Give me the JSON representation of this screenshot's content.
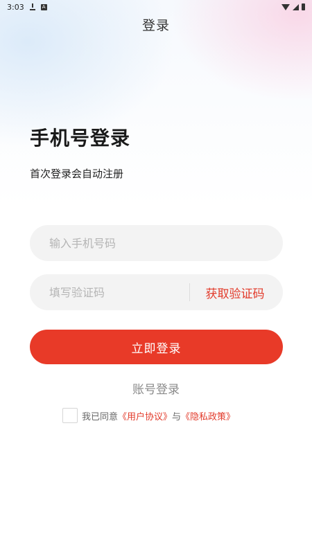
{
  "status_bar": {
    "time": "3:03",
    "icons": [
      "download-icon",
      "a-icon",
      "wifi-icon",
      "signal-icon",
      "battery-icon"
    ]
  },
  "nav": {
    "title": "登录"
  },
  "heading": "手机号登录",
  "subtext": "首次登录会自动注册",
  "phone_field": {
    "placeholder": "输入手机号码",
    "value": ""
  },
  "code_field": {
    "placeholder": "填写验证码",
    "value": "",
    "get_code_label": "获取验证码"
  },
  "login_button": {
    "label": "立即登录"
  },
  "account_login": {
    "label": "账号登录"
  },
  "agreement": {
    "prefix": "我已同意",
    "user_agreement": "《用户协议》",
    "connector": "与",
    "privacy_policy": "《隐私政策》"
  },
  "colors": {
    "accent": "#e83a28",
    "link": "#e23a2a",
    "field_bg": "#f3f3f3",
    "placeholder": "#b5b5b5"
  }
}
